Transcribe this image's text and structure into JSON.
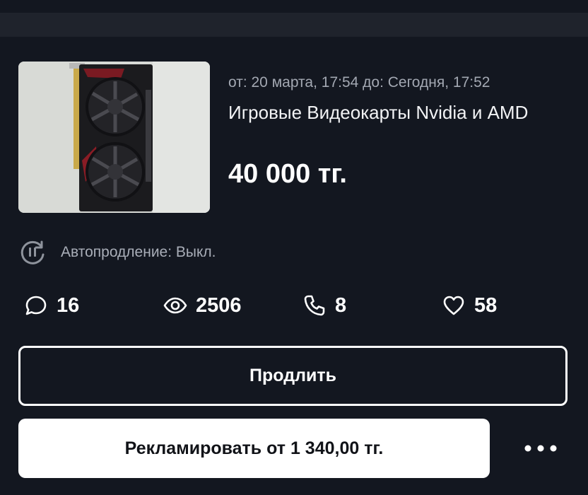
{
  "listing": {
    "date_range": "от: 20 марта, 17:54 до: Сегодня, 17:52",
    "title": "Игровые Видеокарты Nvidia и AMD",
    "price": "40 000 тг.",
    "thumbnail": "graphics-card-photo"
  },
  "auto_renew": {
    "label": "Автопродление: Выкл.",
    "icon": "autorenew-paused-icon"
  },
  "stats": {
    "messages": {
      "icon": "chat-bubble-icon",
      "value": "16"
    },
    "views": {
      "icon": "eye-icon",
      "value": "2506"
    },
    "calls": {
      "icon": "phone-icon",
      "value": "8"
    },
    "favorites": {
      "icon": "heart-icon",
      "value": "58"
    }
  },
  "actions": {
    "extend_label": "Продлить",
    "promote_label": "Рекламировать от 1 340,00 тг.",
    "more_icon": "more-dots-icon"
  },
  "colors": {
    "background": "#131720",
    "top_bar": "#1f232c",
    "secondary_text": "#a3a8b2",
    "primary_text": "#ffffff"
  }
}
